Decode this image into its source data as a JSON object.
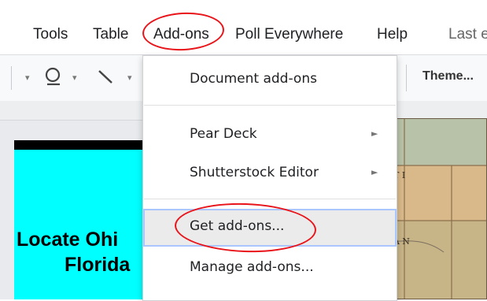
{
  "menubar": {
    "items": [
      "Tools",
      "Table",
      "Add-ons",
      "Poll Everywhere",
      "Help"
    ],
    "last_edit": "Last e"
  },
  "toolbar": {
    "theme_label": "Theme..."
  },
  "addons_menu": {
    "items": [
      {
        "label": "Document add-ons",
        "submenu": false
      },
      {
        "label": "Pear Deck",
        "submenu": true
      },
      {
        "label": "Shutterstock Editor",
        "submenu": true
      },
      {
        "label": "Get add-ons...",
        "submenu": false
      },
      {
        "label": "Manage add-ons...",
        "submenu": false
      }
    ],
    "highlighted": "Get add-ons..."
  },
  "slide": {
    "title_line1": "Locate Ohi",
    "title_line2": "Florida"
  },
  "colors": {
    "annotation": "#e8141a",
    "slide_bg": "#00ffff",
    "hover_border": "#a9c6ff"
  }
}
